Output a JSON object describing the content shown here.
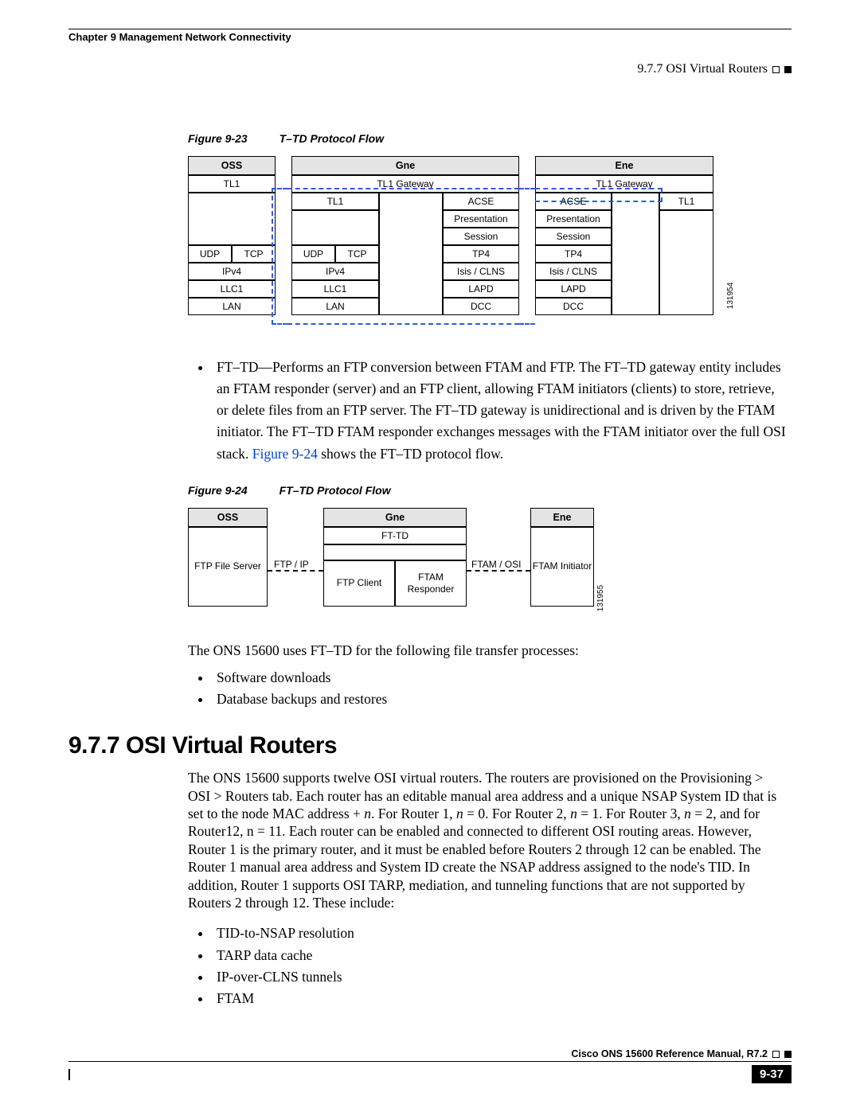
{
  "header": {
    "chapter": "Chapter 9 Management Network Connectivity",
    "section_right": "9.7.7  OSI Virtual Routers"
  },
  "fig23": {
    "caption_num": "Figure 9-23",
    "caption_title": "T–TD Protocol Flow",
    "oss_head": "OSS",
    "gne_head": "Gne",
    "ene_head": "Ene",
    "tl1": "TL1",
    "tl1_gateway": "TL1 Gateway",
    "acse": "ACSE",
    "presentation": "Presentation",
    "session": "Session",
    "udp": "UDP",
    "tcp": "TCP",
    "tp4": "TP4",
    "ipv4": "IPv4",
    "isis": "Isis / CLNS",
    "llc1": "LLC1",
    "lapd": "LAPD",
    "lan": "LAN",
    "dcc": "DCC",
    "diag_id": "131954"
  },
  "para1_text": "FT–TD—Performs an FTP conversion between FTAM and FTP. The FT–TD gateway entity includes an FTAM responder (server) and an FTP client, allowing FTAM initiators (clients) to store, retrieve, or delete files from an FTP server. The FT–TD gateway is unidirectional and is driven by the FTAM initiator. The FT–TD FTAM responder exchanges messages with the FTAM initiator over the full OSI stack. ",
  "para1_link": "Figure 9-24",
  "para1_tail": " shows the FT–TD protocol flow.",
  "fig24": {
    "caption_num": "Figure 9-24",
    "caption_title": "FT–TD Protocol Flow",
    "oss_head": "OSS",
    "gne_head": "Gne",
    "ene_head": "Ene",
    "fttd": "FT-TD",
    "ftp_file_server": "FTP File Server",
    "ftp_ip": "FTP / IP",
    "ftp_client": "FTP Client",
    "ftam_responder": "FTAM Responder",
    "ftam_osi": "FTAM / OSI",
    "ftam_initiator": "FTAM Initiator",
    "diag_id": "131955"
  },
  "para2": "The ONS 15600 uses FT–TD for the following file transfer processes:",
  "list2": [
    "Software downloads",
    "Database backups and restores"
  ],
  "section_heading": "9.7.7  OSI Virtual Routers",
  "para3a": "The ONS 15600 supports twelve OSI virtual routers. The routers are provisioned on the Provisioning > OSI > Routers tab. Each router has an editable manual area address and a unique NSAP System ID that is set to the node MAC address + ",
  "para3b": ". For Router 1, ",
  "para3c": " = 0. For Router 2, ",
  "para3d": " = 1. For Router 3, ",
  "para3e": " = 2, and for Router12, n = 11. Each router can be enabled and connected to different OSI routing areas. However, Router 1 is the primary router, and it must be enabled before Routers 2 through 12 can be enabled. The Router 1 manual area address and System ID create the NSAP address assigned to the node's TID. In addition, Router 1 supports OSI TARP, mediation, and tunneling functions that are not supported by Routers 2 through 12. These include:",
  "n": "n",
  "list3": [
    "TID-to-NSAP resolution",
    "TARP data cache",
    "IP-over-CLNS tunnels",
    "FTAM"
  ],
  "footer": {
    "manual": "Cisco ONS 15600 Reference Manual, R7.2",
    "page": "9-37"
  }
}
